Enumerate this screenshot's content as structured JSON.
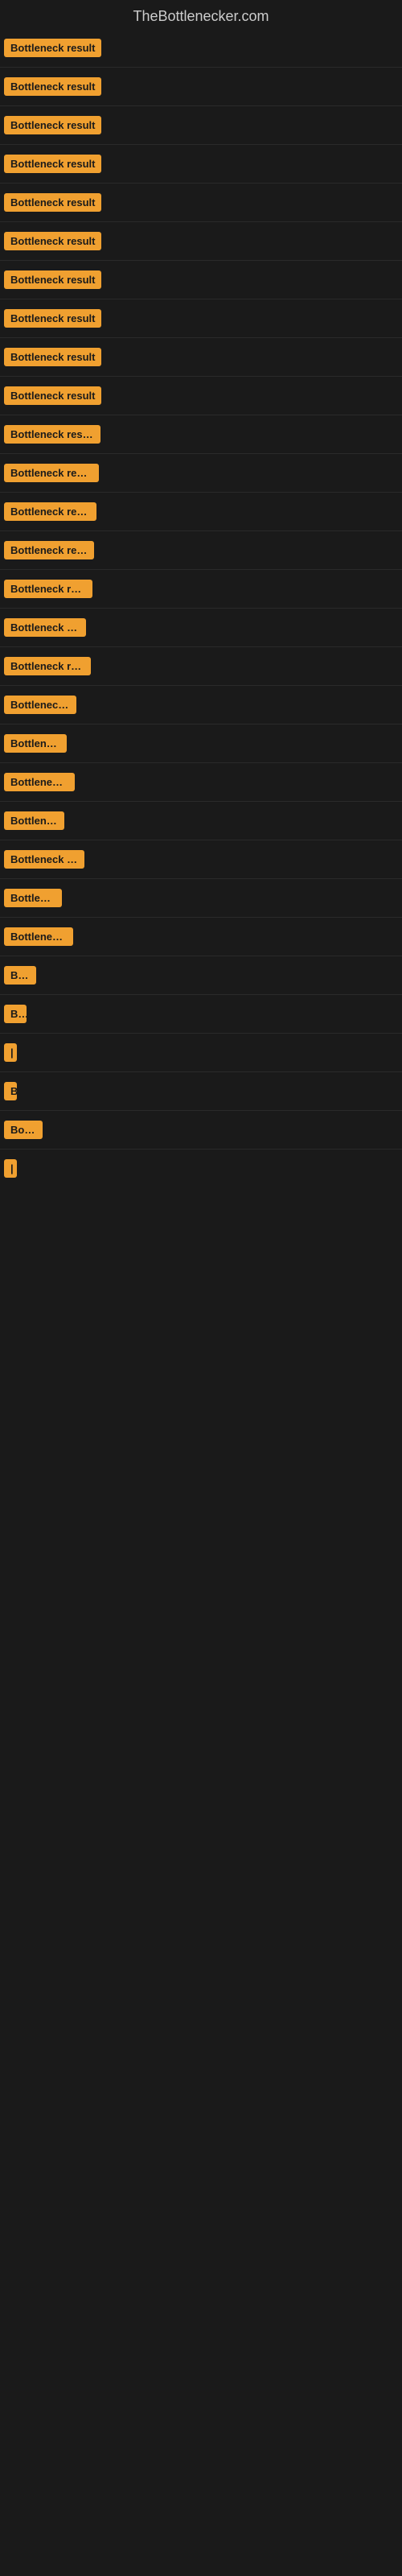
{
  "site": {
    "title": "TheBottlenecker.com"
  },
  "items": [
    {
      "label": "Bottleneck result",
      "width": 140
    },
    {
      "label": "Bottleneck result",
      "width": 138
    },
    {
      "label": "Bottleneck result",
      "width": 135
    },
    {
      "label": "Bottleneck result",
      "width": 133
    },
    {
      "label": "Bottleneck result",
      "width": 132
    },
    {
      "label": "Bottleneck result",
      "width": 130
    },
    {
      "label": "Bottleneck result",
      "width": 128
    },
    {
      "label": "Bottleneck result",
      "width": 126
    },
    {
      "label": "Bottleneck result",
      "width": 124
    },
    {
      "label": "Bottleneck result",
      "width": 122
    },
    {
      "label": "Bottleneck result",
      "width": 120
    },
    {
      "label": "Bottleneck result",
      "width": 118
    },
    {
      "label": "Bottleneck result",
      "width": 115
    },
    {
      "label": "Bottleneck result",
      "width": 112
    },
    {
      "label": "Bottleneck result",
      "width": 110
    },
    {
      "label": "Bottleneck res",
      "width": 102
    },
    {
      "label": "Bottleneck result",
      "width": 108
    },
    {
      "label": "Bottleneck r",
      "width": 90
    },
    {
      "label": "Bottleneck",
      "width": 78
    },
    {
      "label": "Bottleneck r",
      "width": 88
    },
    {
      "label": "Bottleneck",
      "width": 75
    },
    {
      "label": "Bottleneck res",
      "width": 100
    },
    {
      "label": "Bottlenec",
      "width": 72
    },
    {
      "label": "Bottleneck r",
      "width": 86
    },
    {
      "label": "Bott",
      "width": 40
    },
    {
      "label": "Bo",
      "width": 28
    },
    {
      "label": "|",
      "width": 8
    },
    {
      "label": "B",
      "width": 14
    },
    {
      "label": "Bottle",
      "width": 48
    },
    {
      "label": "|",
      "width": 8
    }
  ]
}
